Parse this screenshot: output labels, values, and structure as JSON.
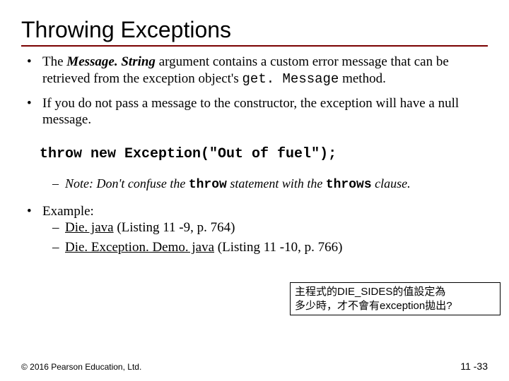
{
  "title": "Throwing Exceptions",
  "bullets": {
    "b1_pre": "The ",
    "b1_em": "Message. String",
    "b1_mid": " argument contains a custom error message that can be retrieved from the exception object's ",
    "b1_code": "get. Message",
    "b1_post": " method.",
    "b2": "If you do not pass a message to the constructor, the exception will have a null message."
  },
  "code": "throw new Exception(\"Out of fuel\");",
  "note_pre": "Note: Don't confuse the ",
  "note_kw1": "throw",
  "note_mid": " statement with the ",
  "note_kw2": "throws",
  "note_post": " clause.",
  "example_label": "Example:",
  "ex1_link": "Die. java",
  "ex1_rest": " (Listing 11 -9, p. 764)",
  "ex2_link": "Die. Exception. Demo. java",
  "ex2_rest": " (Listing 11 -10, p. 766)",
  "callout_l1": "主程式的DIE_SIDES的值設定為",
  "callout_l2a": "多少時，才不會有",
  "callout_l2b": "exception",
  "callout_l2c": "拋出?",
  "footer": "© 2016 Pearson Education, Ltd.",
  "pagenum": "11 -33"
}
